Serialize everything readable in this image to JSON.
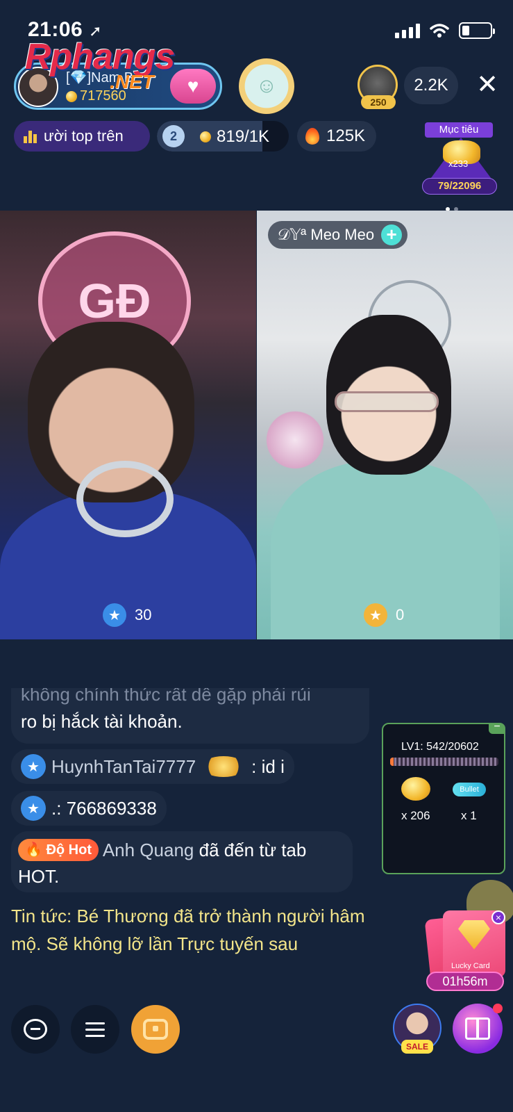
{
  "status_bar": {
    "time": "21:06",
    "location_icon": "location-arrow-icon",
    "signal_icon": "cellular-signal-icon",
    "wifi_icon": "wifi-icon",
    "battery_icon": "battery-icon"
  },
  "watermark": {
    "brand": "Rphangs",
    "suffix": ".NET"
  },
  "host": {
    "name": "[💎]Nam B",
    "coins": "717560",
    "follow_icon": "heart-icon"
  },
  "viewer": {
    "level": "250",
    "count": "2.2K"
  },
  "top_pills": {
    "top_list": "ười top trên",
    "level_badge": "2",
    "level_progress": "819/1K",
    "hot_count": "125K"
  },
  "goal": {
    "title": "Mục tiêu",
    "multiplier": "x233",
    "progress": "79/22096"
  },
  "cohost": {
    "name": "𝒟𝕐ª Meo Meo",
    "add_label": "+"
  },
  "scores": {
    "left": "30",
    "right": "0"
  },
  "chat": {
    "faded_line1": "không chính thức rất dễ gặp phải rủi",
    "faded_line2": "ro bị hắck tài khoản.",
    "row1_user": "HuynhTanTai7777",
    "row1_message": ": id i",
    "row2_message": ".: 766869338",
    "row3_tag": "Độ Hot",
    "row3_user": "Anh Quang",
    "row3_message": "đã đến từ tab HOT."
  },
  "news": "Tin tức: Bé Thương đã trở thành người hâm mộ. Sẽ không lỡ lần Trực tuyến sau",
  "lv_panel": {
    "minimize_label": "−",
    "level_text": "LV1: 542/20602",
    "gold_count": "x 206",
    "bullet_label": "Bullet",
    "bullet_count": "x 1"
  },
  "lucky_card": {
    "label": "Lucky Card",
    "close": "×",
    "timer": "01h56m"
  },
  "bottom": {
    "sale_label": "SALE"
  }
}
